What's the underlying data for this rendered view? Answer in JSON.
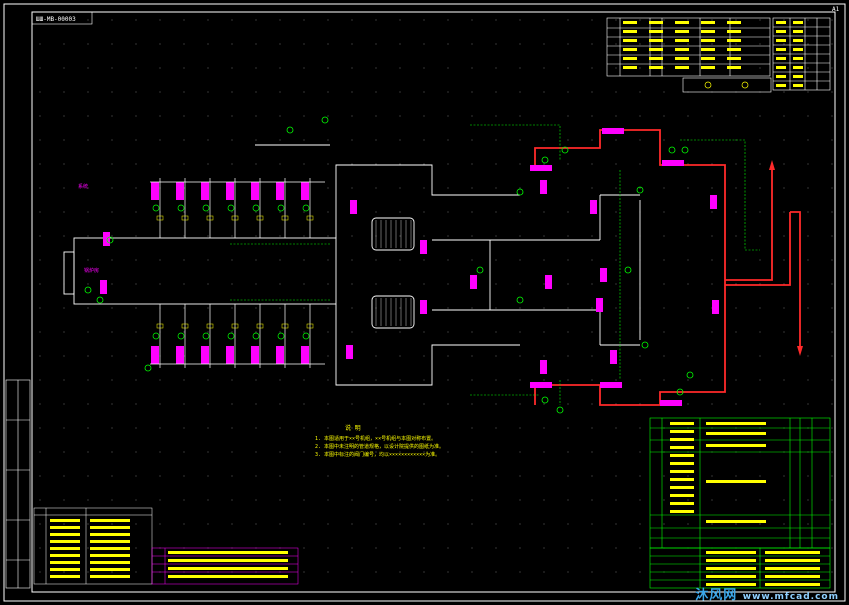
{
  "drawing": {
    "sheet_number": "ШШ-МВ-00003",
    "notes_heading": "说 明",
    "notes": [
      "1. 本图适用于××号机组，××号机组与本图对称布置。",
      "2. 本图中未注明的管道规格，以设计院提供的图纸为准。",
      "3. 本图中标注的阀门编号，均以××××××××××××为准。"
    ],
    "sys_label": "系统",
    "boiler_label": "锅炉房",
    "watermark": "沐风网",
    "watermark_sub": "www.mfcad.com",
    "revision_mark": "A1"
  },
  "colors": {
    "background": "#000000",
    "frame": "#ffffff",
    "steam_pipe": "#ff2a2a",
    "instrument": "#ff00ff",
    "signal_line": "#00ff00",
    "text": "#ffff00",
    "table_line": "#00ff00",
    "accent_cyan": "#00ffff"
  }
}
